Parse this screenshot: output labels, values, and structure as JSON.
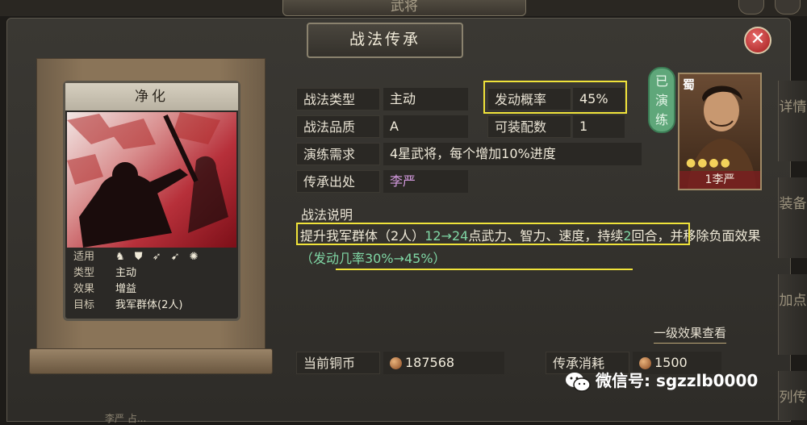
{
  "top_tab": "武将",
  "window_title": "战法传承",
  "close_label": "✕",
  "card": {
    "name": "净化",
    "rows": [
      {
        "key": "适用",
        "value": ""
      },
      {
        "key": "类型",
        "value": "主动"
      },
      {
        "key": "效果",
        "value": "增益"
      },
      {
        "key": "目标",
        "value": "我军群体(2人)"
      }
    ],
    "troop_icons": [
      "cavalry-icon",
      "shield-icon",
      "bow-icon",
      "spear-icon",
      "siege-icon"
    ]
  },
  "fields": {
    "type_label": "战法类型",
    "type_value": "主动",
    "quality_label": "战法品质",
    "quality_value": "A",
    "train_label": "演练需求",
    "train_value": "4星武将，每个增加10%进度",
    "source_label": "传承出处",
    "source_value": "李严",
    "prob_label": "发动概率",
    "prob_value": "45%",
    "slots_label": "可装配数",
    "slots_value": "1"
  },
  "description": {
    "title": "战法说明",
    "part1": "提升我军群体（2人）",
    "part2": "12→24",
    "part3": "点武力、智力、速度，",
    "part4": "持续",
    "part5": "2",
    "part6": "回合，",
    "part7": "并移除负面效果",
    "part8": "（发动几率30%→45%）"
  },
  "level_link": "一级效果查看",
  "coins": {
    "label": "当前铜币",
    "value": "187568"
  },
  "cost": {
    "label": "传承消耗",
    "value": "1500"
  },
  "hero": {
    "faction": "蜀",
    "name": "1李严",
    "stars": "●●●●"
  },
  "trained_badge": "已演练",
  "side_tabs": [
    "详情",
    "装备",
    "加点",
    "列传"
  ],
  "watermark": "微信号: sgzzlb0000",
  "bottom_text": "李严 占..."
}
